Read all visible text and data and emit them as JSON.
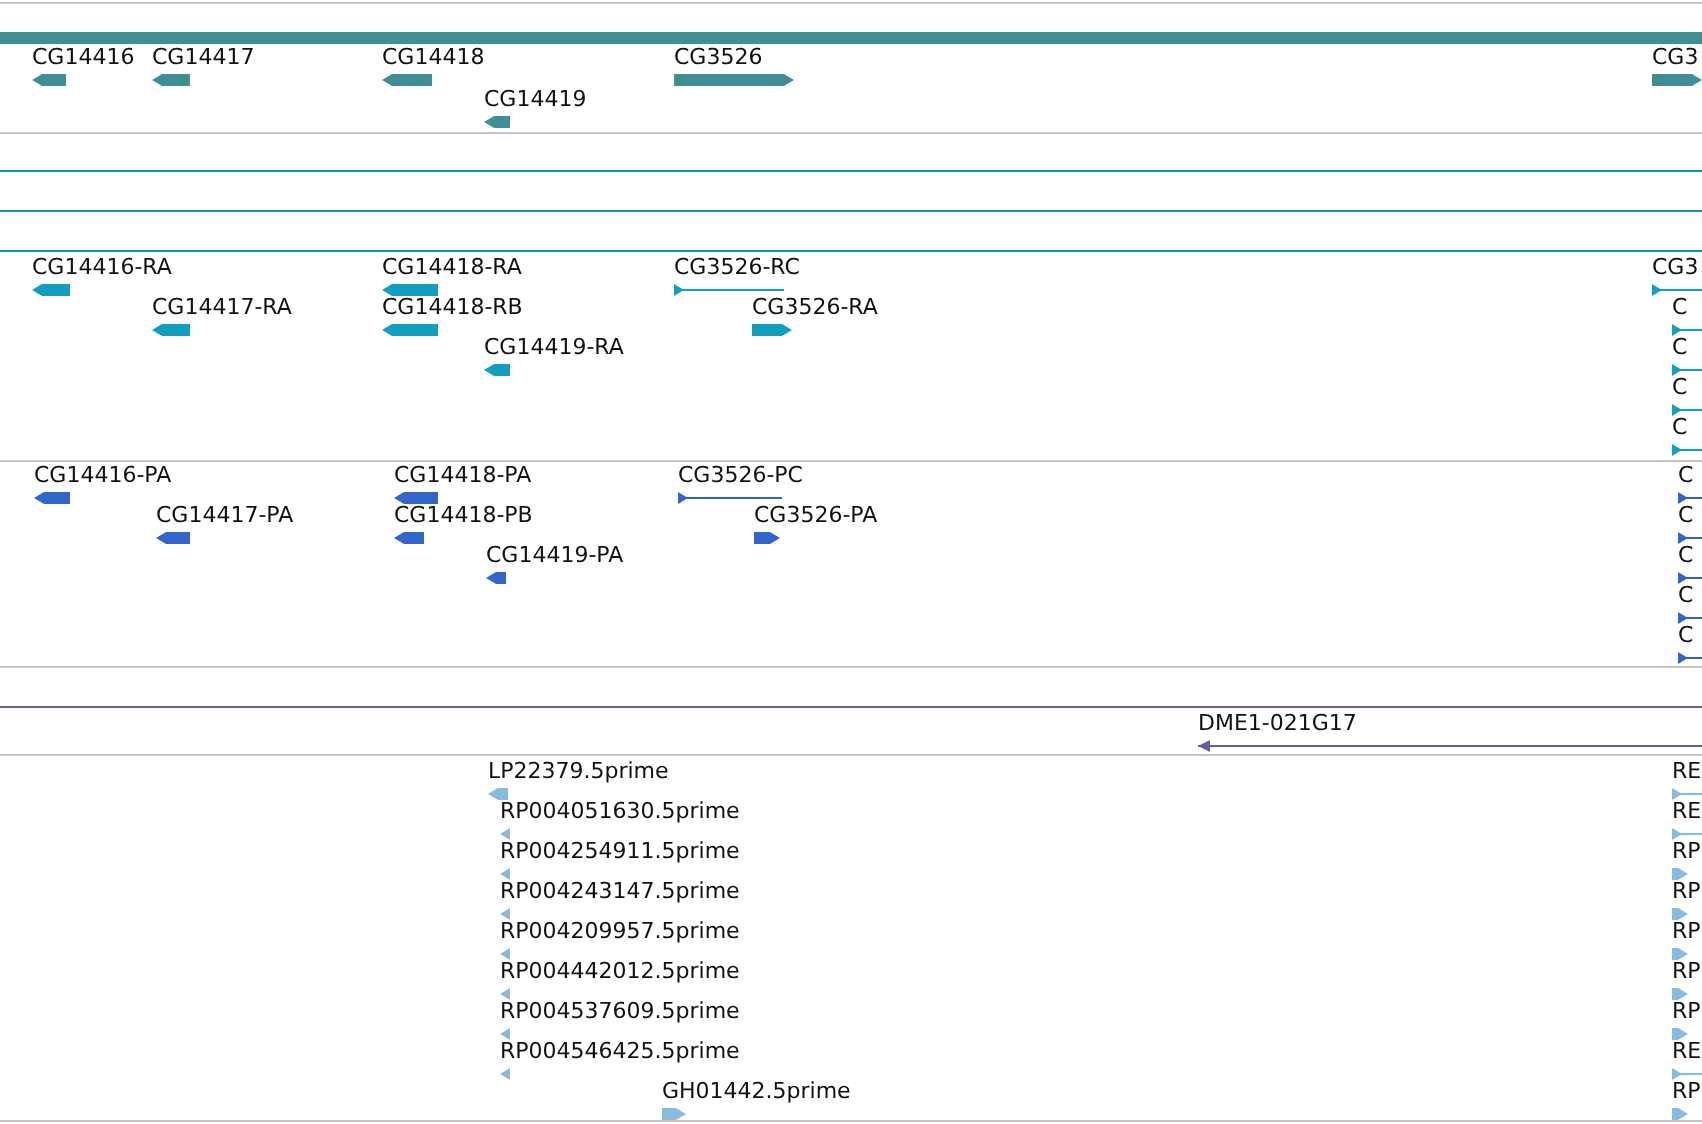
{
  "tracks": [
    {
      "kind": "features",
      "color": "#3f8f94",
      "region_bar": true,
      "features": [
        {
          "label": "CG14416",
          "reverse": true
        },
        {
          "label": "CG14417",
          "reverse": true
        },
        {
          "label": "CG14418",
          "reverse": true
        },
        {
          "label": "CG14419",
          "reverse": true
        },
        {
          "label": "CG3526",
          "reverse": false
        },
        {
          "label": "CG3",
          "reverse": false
        }
      ]
    },
    {
      "kind": "empty",
      "color": "#1a8fa8"
    },
    {
      "kind": "empty",
      "color": "#1a8fa8"
    },
    {
      "kind": "empty",
      "color": "#1a8fa8"
    },
    {
      "kind": "features",
      "color": "#119fc0",
      "features": [
        {
          "label": "CG14416-RA",
          "reverse": true
        },
        {
          "label": "CG14417-RA",
          "reverse": true
        },
        {
          "label": "CG14418-RA",
          "reverse": true
        },
        {
          "label": "CG14418-RB",
          "reverse": true
        },
        {
          "label": "CG14419-RA",
          "reverse": true
        },
        {
          "label": "CG3526-RC",
          "reverse": false
        },
        {
          "label": "CG3526-RA",
          "reverse": false
        },
        {
          "label": "CG3",
          "reverse": false
        },
        {
          "label": "C",
          "reverse": false
        },
        {
          "label": "C",
          "reverse": false
        },
        {
          "label": "C",
          "reverse": false
        },
        {
          "label": "C",
          "reverse": false
        }
      ]
    },
    {
      "kind": "features",
      "color": "#3366cc",
      "features": [
        {
          "label": "CG14416-PA",
          "reverse": true
        },
        {
          "label": "CG14417-PA",
          "reverse": true
        },
        {
          "label": "CG14418-PA",
          "reverse": true
        },
        {
          "label": "CG14418-PB",
          "reverse": true
        },
        {
          "label": "CG14419-PA",
          "reverse": true
        },
        {
          "label": "CG3526-PC",
          "reverse": false
        },
        {
          "label": "CG3526-PA",
          "reverse": false
        },
        {
          "label": "C",
          "reverse": false
        },
        {
          "label": "C",
          "reverse": false
        },
        {
          "label": "C",
          "reverse": false
        },
        {
          "label": "C",
          "reverse": false
        },
        {
          "label": "C",
          "reverse": false
        }
      ]
    },
    {
      "kind": "empty",
      "color": "#6c5aa8"
    },
    {
      "kind": "features",
      "color": "#6c5aa8",
      "features": [
        {
          "label": "DME1-021G17",
          "reverse": true
        }
      ]
    },
    {
      "kind": "features",
      "color": "#88bbdd",
      "features": [
        {
          "label": "LP22379.5prime",
          "reverse": true
        },
        {
          "label": "RP004051630.5prime",
          "reverse": true
        },
        {
          "label": "RP004254911.5prime",
          "reverse": true
        },
        {
          "label": "RP004243147.5prime",
          "reverse": true
        },
        {
          "label": "RP004209957.5prime",
          "reverse": true
        },
        {
          "label": "RP004442012.5prime",
          "reverse": true
        },
        {
          "label": "RP004537609.5prime",
          "reverse": true
        },
        {
          "label": "RP004546425.5prime",
          "reverse": true
        },
        {
          "label": "GH01442.5prime",
          "reverse": false
        },
        {
          "label": "RE",
          "reverse": false
        },
        {
          "label": "RE",
          "reverse": false
        },
        {
          "label": "RP",
          "reverse": false
        },
        {
          "label": "RP",
          "reverse": false
        },
        {
          "label": "RP",
          "reverse": false
        },
        {
          "label": "RP",
          "reverse": false
        },
        {
          "label": "RP",
          "reverse": false
        },
        {
          "label": "RE",
          "reverse": false
        },
        {
          "label": "RP",
          "reverse": false
        }
      ]
    }
  ]
}
